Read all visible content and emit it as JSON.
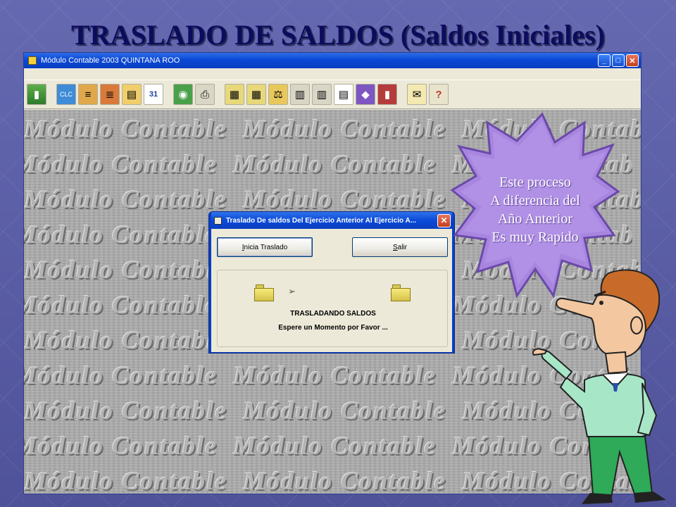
{
  "slide": {
    "title": "TRASLADO DE SALDOS (Saldos Iniciales)"
  },
  "app": {
    "title": "Módulo Contable 2003 QUINTANA ROO",
    "window_buttons": {
      "minimize": "_",
      "maximize": "□",
      "close": "✕"
    },
    "toolbar_icons": [
      "exit-door-icon",
      "clc-catalog-icon",
      "cuentas-icon",
      "poliza-icon",
      "balanza-icon",
      "calendar-31-icon",
      "search-globe-icon",
      "print-icon",
      "report-1-icon",
      "report-2-icon",
      "scale-icon",
      "report-3-icon",
      "report-4-icon",
      "report-5-icon",
      "gem-icon",
      "books-icon",
      "envelope-icon",
      "help-books-icon"
    ],
    "watermark_text": "Módulo Contable"
  },
  "dialog": {
    "title": "Traslado De saldos Del Ejercicio Anterior Al Ejercicio A...",
    "close": "✕",
    "buttons": {
      "start_prefix": "I",
      "start_rest": "nicia Traslado",
      "exit_prefix": "S",
      "exit_rest": "alir"
    },
    "status": "TRASLADANDO SALDOS",
    "message": "Espere un Momento por Favor ..."
  },
  "callout": {
    "lines": [
      "Este proceso",
      "A diferencia del",
      "Año Anterior",
      "Es muy Rapido"
    ]
  },
  "colors": {
    "title": "#0c0c5c",
    "titlebar": "#0a48d6",
    "callout_fill": "#a886e0",
    "callout_outline": "#6a4aa8"
  }
}
